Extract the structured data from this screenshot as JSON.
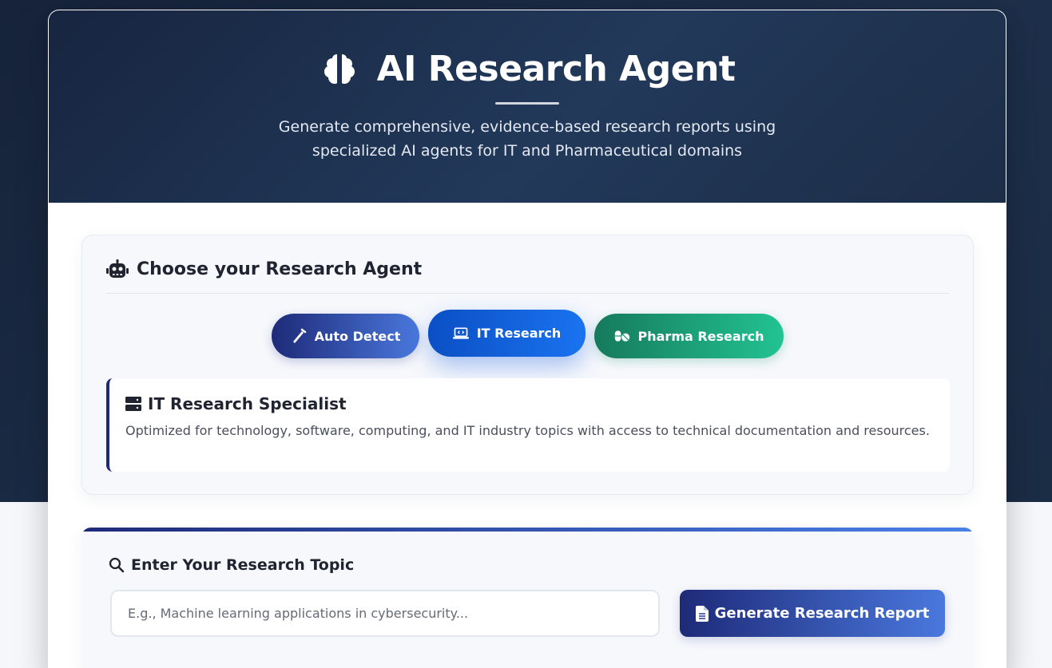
{
  "hero": {
    "title": "AI Research Agent",
    "subtitle_line1": "Generate comprehensive, evidence-based research reports using",
    "subtitle_line2": "specialized AI agents for IT and Pharmaceutical domains",
    "icon": "brain-icon"
  },
  "agent_selector": {
    "heading": "Choose your Research Agent",
    "icon": "robot-icon",
    "buttons": [
      {
        "label": "Auto Detect",
        "icon": "magic-wand-icon",
        "selected": false
      },
      {
        "label": "IT Research",
        "icon": "laptop-code-icon",
        "selected": true
      },
      {
        "label": "Pharma Research",
        "icon": "pills-icon",
        "selected": false
      }
    ]
  },
  "specialist": {
    "title": "IT Research Specialist",
    "icon": "server-icon",
    "description": "Optimized for technology, software, computing, and IT industry topics with access to technical documentation and resources."
  },
  "topic": {
    "heading": "Enter Your Research Topic",
    "icon": "search-icon",
    "input_value": "",
    "input_placeholder": "E.g., Machine learning applications in cybersecurity...",
    "generate_label": "Generate Research Report",
    "generate_icon": "file-document-icon"
  },
  "colors": {
    "hero_bg": "#1c2d47",
    "accent_primary": "#1e2a78",
    "accent_it": "#1a73f0",
    "accent_pharma": "#22c392"
  }
}
